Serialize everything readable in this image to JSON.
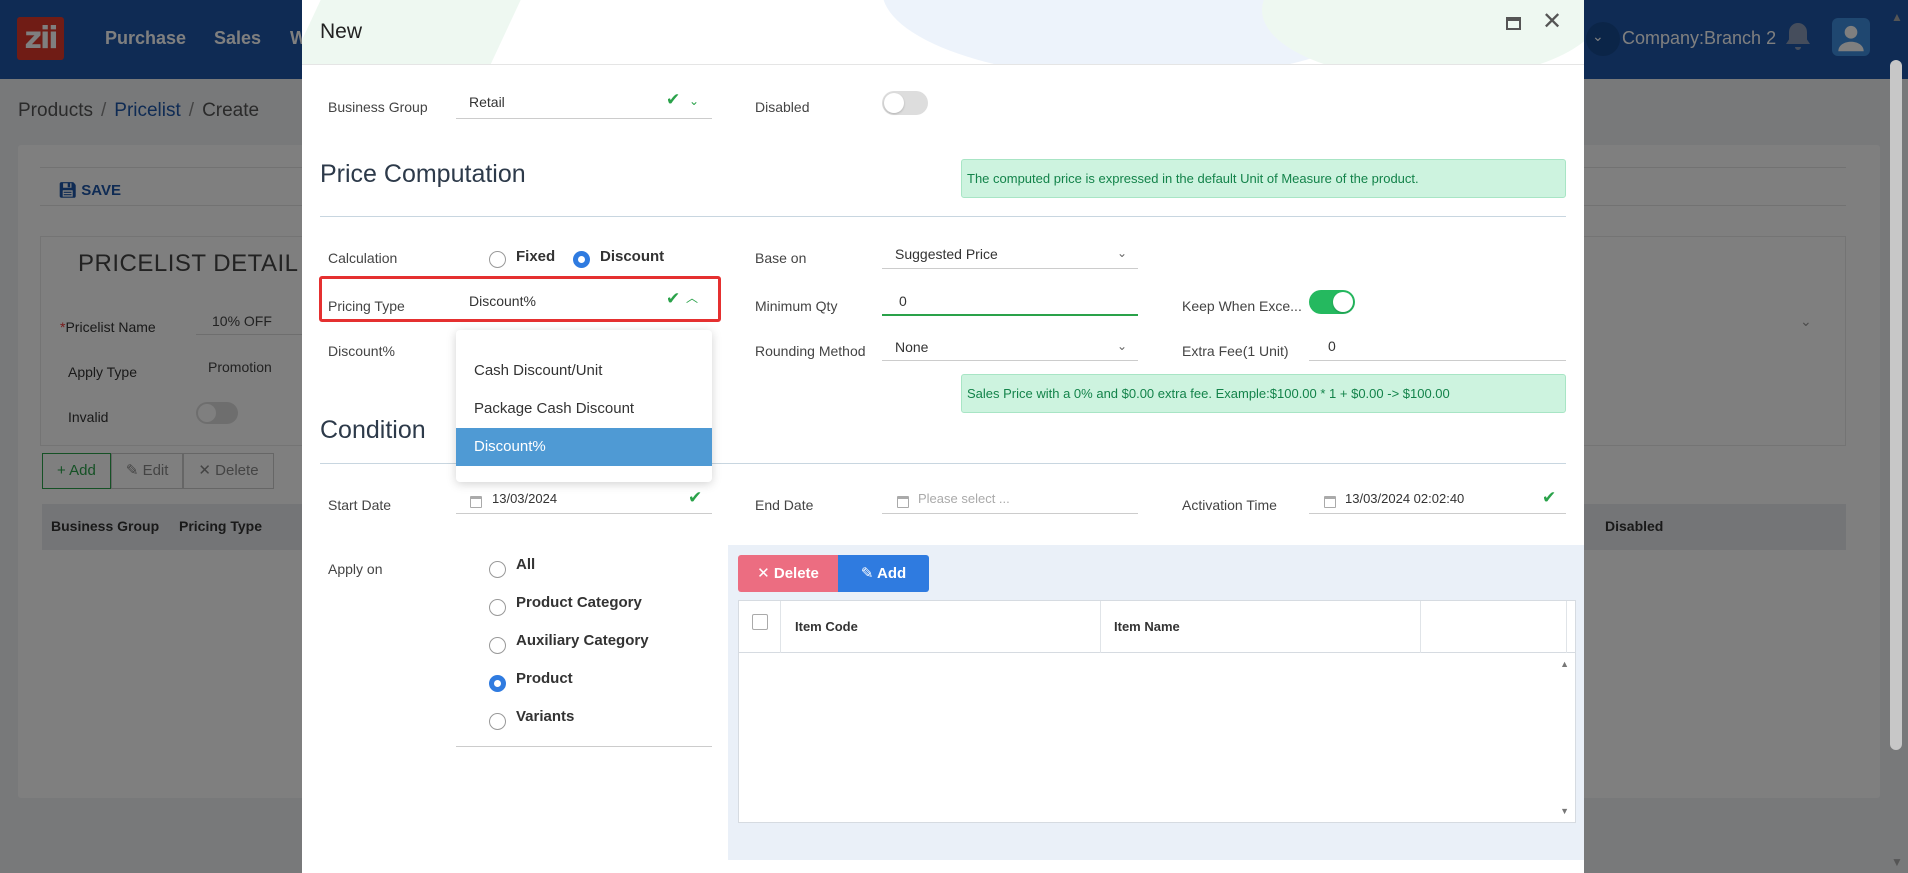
{
  "app": {
    "logo_text": "zii",
    "nav": [
      "Purchase",
      "Sales",
      "W"
    ],
    "company": "Company:Branch 2"
  },
  "breadcrumb": {
    "root": "Products",
    "sep": "/",
    "parent": "Pricelist",
    "current": "Create"
  },
  "background_page": {
    "save_label": "SAVE",
    "detail_title": "PRICELIST DETAIL",
    "fields": {
      "name_label": "Pricelist Name",
      "name_required": "*",
      "name_value": "10% OFF",
      "apply_type_label": "Apply Type",
      "apply_type_value": "Promotion",
      "invalid_label": "Invalid"
    },
    "buttons": {
      "add": "Add",
      "edit": "Edit",
      "delete": "Delete"
    },
    "columns": [
      "Business Group",
      "Pricing Type",
      "Disabled"
    ]
  },
  "modal": {
    "title": "New",
    "business_group": {
      "label": "Business Group",
      "value": "Retail"
    },
    "disabled": {
      "label": "Disabled",
      "on": false
    },
    "price_computation": {
      "title": "Price Computation",
      "note": "The computed price is expressed in the default Unit of Measure of the product.",
      "calculation": {
        "label": "Calculation",
        "options": [
          "Fixed",
          "Discount"
        ],
        "selected": "Discount"
      },
      "base_on": {
        "label": "Base on",
        "value": "Suggested Price"
      },
      "pricing_type": {
        "label": "Pricing Type",
        "value": "Discount%"
      },
      "minimum_qty": {
        "label": "Minimum Qty",
        "value": "0"
      },
      "keep_when_exceed": {
        "label": "Keep When Exce...",
        "on": true
      },
      "discount_pct": {
        "label": "Discount%"
      },
      "rounding_method": {
        "label": "Rounding Method",
        "value": "None"
      },
      "extra_fee": {
        "label": "Extra Fee(1 Unit)",
        "value": "0"
      },
      "example_note": "Sales Price with a 0% and $0.00 extra fee. Example:$100.00 * 1 + $0.00 -> $100.00"
    },
    "pricing_type_dropdown": {
      "options": [
        "Cash Discount/Unit",
        "Package Cash Discount",
        "Discount%"
      ],
      "selected": "Discount%"
    },
    "condition": {
      "title": "Condition",
      "start_date": {
        "label": "Start Date",
        "value": "13/03/2024"
      },
      "end_date": {
        "label": "End Date",
        "placeholder": "Please select ..."
      },
      "activation_time": {
        "label": "Activation Time",
        "value": "13/03/2024 02:02:40"
      },
      "apply_on": {
        "label": "Apply on",
        "options": [
          "All",
          "Product Category",
          "Auxiliary Category",
          "Product",
          "Variants"
        ],
        "selected": "Product"
      }
    },
    "grid": {
      "delete_label": "Delete",
      "add_label": "Add",
      "columns": [
        "Item Code",
        "Item Name"
      ]
    }
  },
  "colors": {
    "topbar": "#1e57a8",
    "accent_blue": "#2f7be0",
    "success_green": "#2aa24a",
    "alert_bg": "#cdf3df",
    "delete_pink": "#ec6d81",
    "highlight_red": "#e53030"
  }
}
